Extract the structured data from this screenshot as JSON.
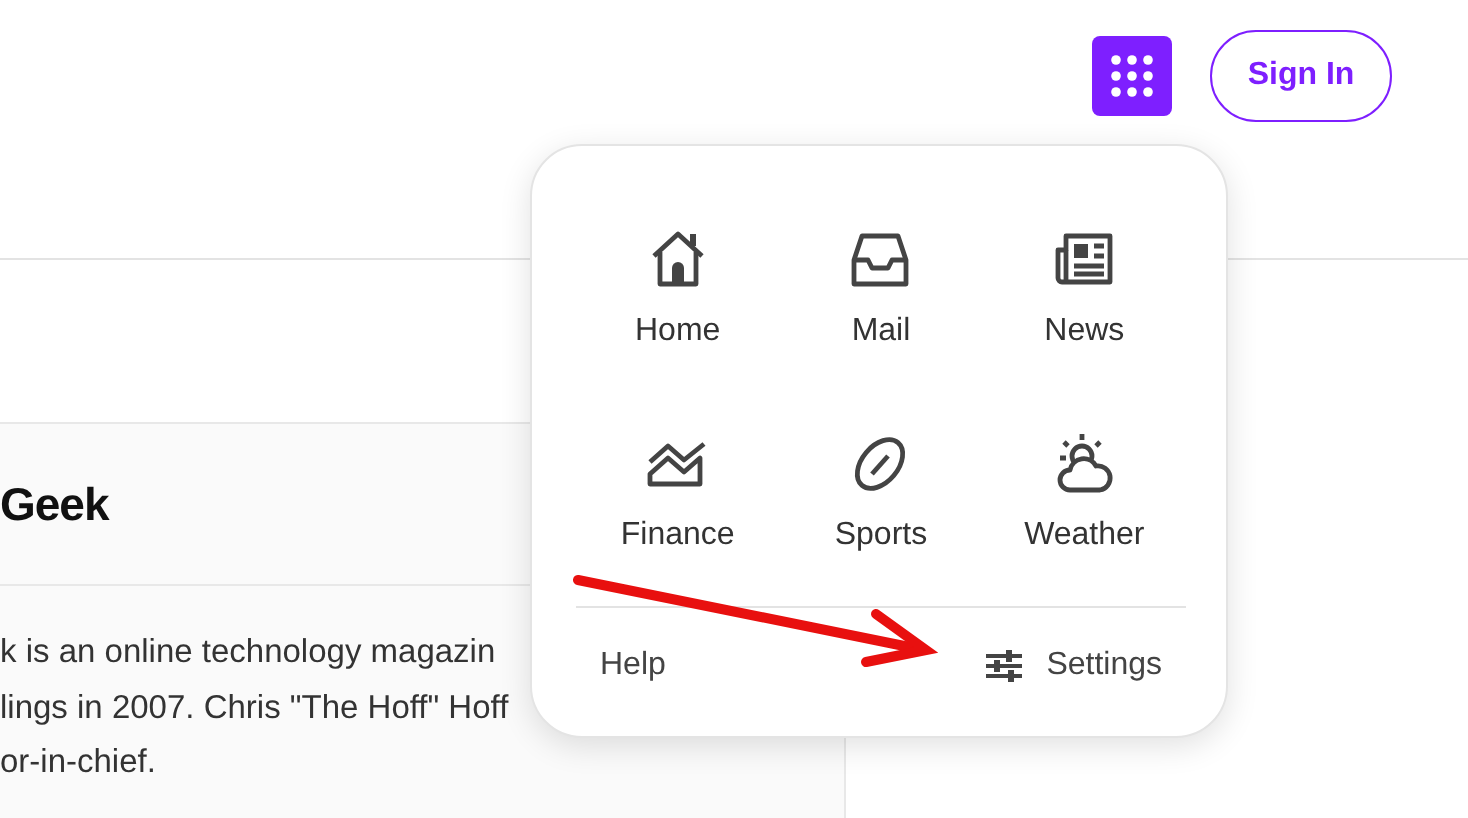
{
  "header": {
    "sign_in": "Sign In"
  },
  "card": {
    "title": "Geek",
    "lines": [
      "k is an online technology magazin",
      "lings in 2007. Chris \"The Hoff\" Hoff",
      "or-in-chief."
    ]
  },
  "apps_menu": {
    "apps": [
      {
        "label": "Home"
      },
      {
        "label": "Mail"
      },
      {
        "label": "News"
      },
      {
        "label": "Finance"
      },
      {
        "label": "Sports"
      },
      {
        "label": "Weather"
      }
    ],
    "help": "Help",
    "settings": "Settings"
  }
}
